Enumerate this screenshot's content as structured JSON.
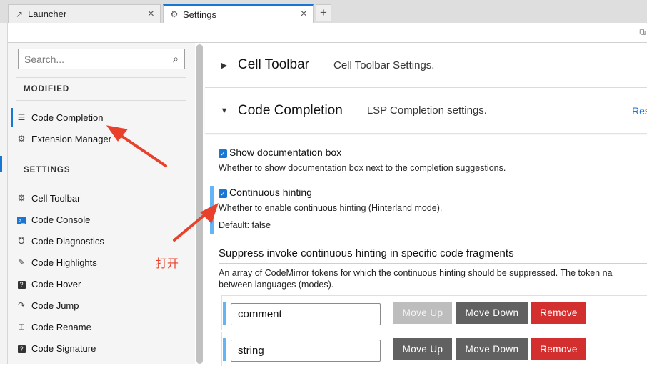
{
  "tabs": [
    {
      "label": "Launcher",
      "icon": "launcher-icon"
    },
    {
      "label": "Settings",
      "icon": "gear-icon",
      "active": true
    }
  ],
  "sidebar": {
    "search_placeholder": "Search...",
    "modified_title": "MODIFIED",
    "modified_items": [
      {
        "label": "Code Completion",
        "icon": "list-icon",
        "active": true
      },
      {
        "label": "Extension Manager",
        "icon": "gear-icon"
      }
    ],
    "settings_title": "SETTINGS",
    "settings_items": [
      {
        "label": "Cell Toolbar",
        "icon": "gear-icon"
      },
      {
        "label": "Code Console",
        "icon": "terminal-icon"
      },
      {
        "label": "Code Diagnostics",
        "icon": "stethoscope-icon"
      },
      {
        "label": "Code Highlights",
        "icon": "highlighter-icon"
      },
      {
        "label": "Code Hover",
        "icon": "help-icon"
      },
      {
        "label": "Code Jump",
        "icon": "jump-icon"
      },
      {
        "label": "Code Rename",
        "icon": "rename-icon"
      },
      {
        "label": "Code Signature",
        "icon": "help-icon"
      }
    ]
  },
  "main": {
    "sections": [
      {
        "title": "Cell Toolbar",
        "description": "Cell Toolbar Settings.",
        "expanded": false
      },
      {
        "title": "Code Completion",
        "description": "LSP Completion settings.",
        "expanded": true,
        "reset_label": "Res"
      }
    ],
    "fields": {
      "show_doc": {
        "label": "Show documentation box",
        "checked": true,
        "help": "Whether to show documentation box next to the completion suggestions."
      },
      "continuous": {
        "label": "Continuous hinting",
        "checked": true,
        "help": "Whether to enable continuous hinting (Hinterland mode).",
        "default": "Default: false"
      }
    },
    "suppress": {
      "title": "Suppress invoke continuous hinting in specific code fragments",
      "description_line1": "An array of CodeMirror tokens for which the continuous hinting should be suppressed. The token na",
      "description_line2": "between languages (modes).",
      "items": [
        {
          "value": "comment"
        },
        {
          "value": "string"
        }
      ],
      "buttons": {
        "up": "Move Up",
        "down": "Move Down",
        "remove": "Remove"
      }
    }
  },
  "annotation": {
    "text": "打开",
    "color": "#e8402b"
  },
  "colors": {
    "accent": "#1976d2",
    "danger": "#d32f2f",
    "secondary": "#616161",
    "modified": "#64b5f6"
  }
}
